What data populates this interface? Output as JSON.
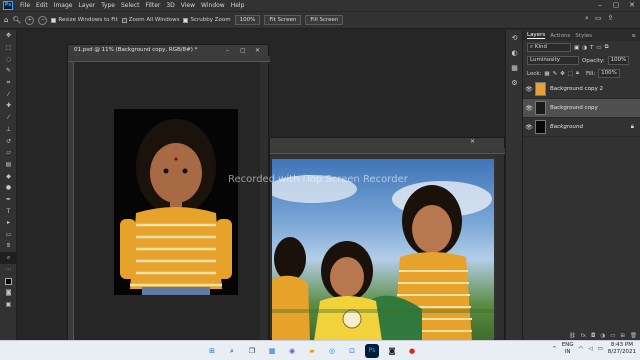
{
  "app": {
    "logo": "Ps",
    "menu": [
      "File",
      "Edit",
      "Image",
      "Layer",
      "Type",
      "Select",
      "Filter",
      "3D",
      "View",
      "Window",
      "Help"
    ],
    "window_controls": [
      "–",
      "▢",
      "✕"
    ]
  },
  "options_bar": {
    "resize_windows": "Resize Windows to Fit",
    "zoom_all": "Zoom All Windows",
    "scrubby_zoom": "Scrubby Zoom",
    "zoom_value": "100%",
    "fit_screen": "Fit Screen",
    "fill_screen": "Fill Screen"
  },
  "documents": [
    {
      "title": "01.psd @ 11% (Background copy, RGB/8#) *"
    }
  ],
  "watermark": "Recorded with iTop Screen Recorder",
  "layers_panel": {
    "tabs": [
      "Layers",
      "Actions",
      "Styles"
    ],
    "active_tab": "Layers",
    "kind_label": "Kind",
    "blend_mode": "Luminosity",
    "opacity_label": "Opacity:",
    "opacity_value": "100%",
    "lock_label": "Lock:",
    "fill_label": "Fill:",
    "fill_value": "100%",
    "layers": [
      {
        "name": "Background copy 2",
        "selected": false,
        "italic": false,
        "locked": false,
        "thumb": "#e3a13a"
      },
      {
        "name": "Background copy",
        "selected": true,
        "italic": false,
        "locked": false,
        "thumb": "#1a1a1a"
      },
      {
        "name": "Background",
        "selected": false,
        "italic": true,
        "locked": true,
        "thumb": "#080808"
      }
    ]
  },
  "taskbar": {
    "lang_top": "ENG",
    "lang_bottom": "IN",
    "time": "8:43 PM",
    "date": "8/27/2021"
  },
  "colors": {
    "accent": "#31a8ff",
    "panel_bg": "#323232",
    "workspace_bg": "#262626"
  }
}
